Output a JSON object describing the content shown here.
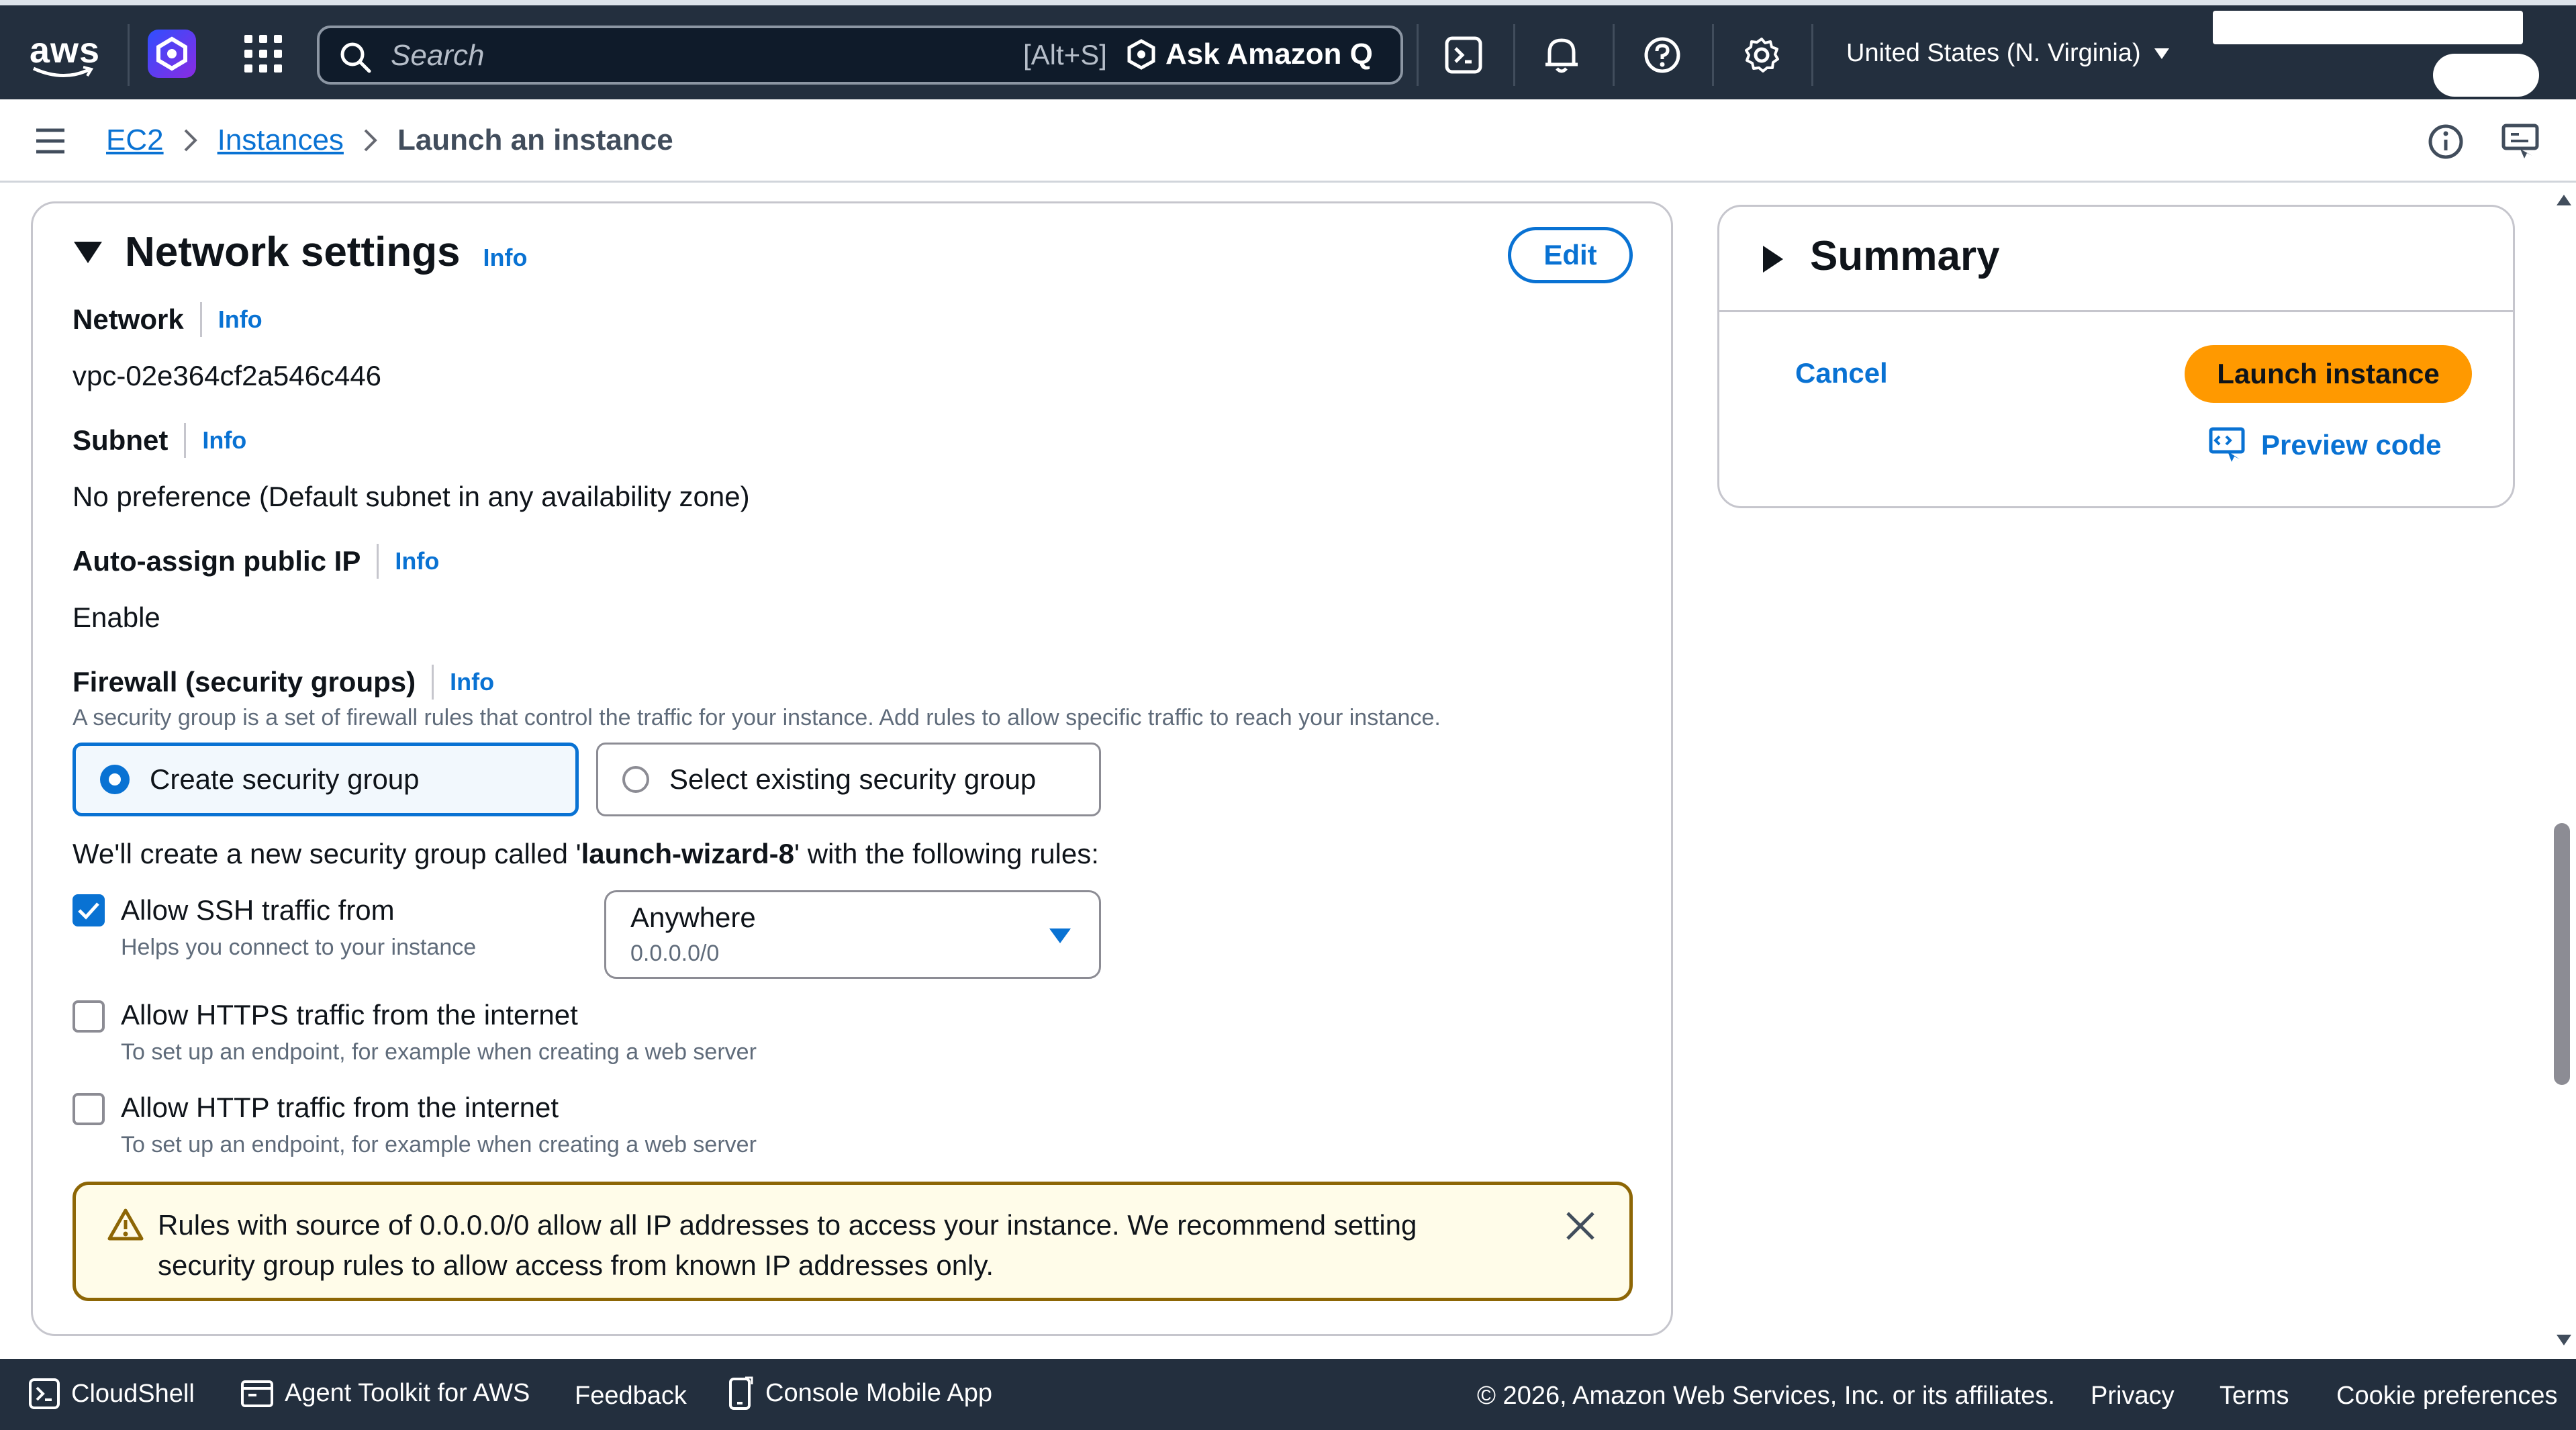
{
  "topnav": {
    "logo_text": "aws",
    "search_placeholder": "Search",
    "search_shortcut": "[Alt+S]",
    "ask_q_label": "Ask Amazon Q",
    "region_label": "United States (N. Virginia)"
  },
  "breadcrumb": {
    "items": [
      "EC2",
      "Instances",
      "Launch an instance"
    ]
  },
  "network": {
    "title": "Network settings",
    "info": "Info",
    "edit_label": "Edit",
    "network_label": "Network",
    "network_value": "vpc-02e364cf2a546c446",
    "subnet_label": "Subnet",
    "subnet_value": "No preference (Default subnet in any availability zone)",
    "public_ip_label": "Auto-assign public IP",
    "public_ip_value": "Enable",
    "firewall_label": "Firewall (security groups)",
    "firewall_desc": "A security group is a set of firewall rules that control the traffic for your instance. Add rules to allow specific traffic to reach your instance.",
    "sg_options": [
      "Create security group",
      "Select existing security group"
    ],
    "sg_selected": "Create security group",
    "new_sg_prefix": "We'll create a new security group called '",
    "new_sg_name": "launch-wizard-8",
    "new_sg_suffix": "' with the following rules:",
    "rules": [
      {
        "label": "Allow SSH traffic from",
        "desc": "Helps you connect to your instance",
        "checked": true
      },
      {
        "label": "Allow HTTPS traffic from the internet",
        "desc": "To set up an endpoint, for example when creating a web server",
        "checked": false
      },
      {
        "label": "Allow HTTP traffic from the internet",
        "desc": "To set up an endpoint, for example when creating a web server",
        "checked": false
      }
    ],
    "ssh_source": {
      "value": "Anywhere",
      "sub": "0.0.0.0/0"
    },
    "warning_line1": "Rules with source of 0.0.0.0/0 allow all IP addresses to access your instance. We recommend setting",
    "warning_line2": "security group rules to allow access from known IP addresses only."
  },
  "summary": {
    "title": "Summary",
    "cancel_label": "Cancel",
    "launch_label": "Launch instance",
    "preview_label": "Preview code"
  },
  "footer": {
    "cloudshell": "CloudShell",
    "agent_toolkit": "Agent Toolkit for AWS",
    "feedback": "Feedback",
    "mobile_app": "Console Mobile App",
    "copyright": "© 2026, Amazon Web Services, Inc. or its affiliates.",
    "privacy": "Privacy",
    "terms": "Terms",
    "cookies": "Cookie preferences"
  },
  "colors": {
    "nav_bg": "#232f3e",
    "link": "#0972d3",
    "launch": "#ff9900",
    "warning_border": "#8d6605",
    "warning_bg": "#fffce9"
  }
}
